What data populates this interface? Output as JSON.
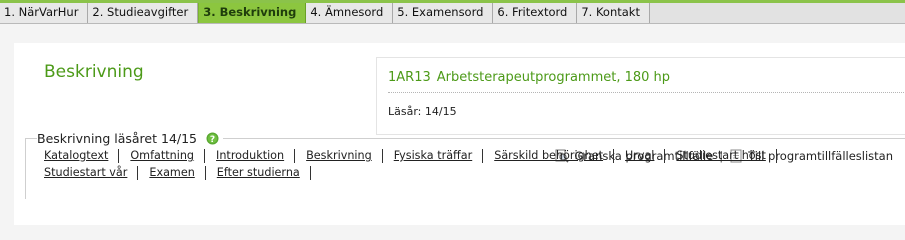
{
  "tabs": [
    {
      "label": "1. NärVarHur",
      "active": false
    },
    {
      "label": "2. Studieavgifter",
      "active": false
    },
    {
      "label": "3. Beskrivning",
      "active": true
    },
    {
      "label": "4. Ämnesord",
      "active": false
    },
    {
      "label": "5. Examensord",
      "active": false
    },
    {
      "label": "6. Fritextord",
      "active": false
    },
    {
      "label": "7. Kontakt",
      "active": false
    }
  ],
  "page_title": "Beskrivning",
  "program": {
    "code": "1AR13",
    "name": "Arbetsterapeutprogrammet, 180 hp",
    "year_label": "Läsår:",
    "year_value": "14/15"
  },
  "actions": {
    "review_label": "Granska programtillfälle",
    "separator": "|",
    "list_label": "Till programtillfälleslistan"
  },
  "section": {
    "legend": "Beskrivning läsåret 14/15",
    "links_row1": [
      "Katalogtext",
      "Omfattning",
      "Introduktion",
      "Beskrivning",
      "Fysiska träffar",
      "Särskild behörighet",
      "Urval",
      "Studiestart höst"
    ],
    "links_row2": [
      "Studiestart vår",
      "Examen",
      "Efter studierna"
    ]
  },
  "colors": {
    "accent_green": "#8cc63f",
    "title_green": "#4c9a18"
  },
  "icons": {
    "review": "magnifier-document-icon",
    "list": "document-list-icon",
    "info": "info-circle-icon"
  }
}
